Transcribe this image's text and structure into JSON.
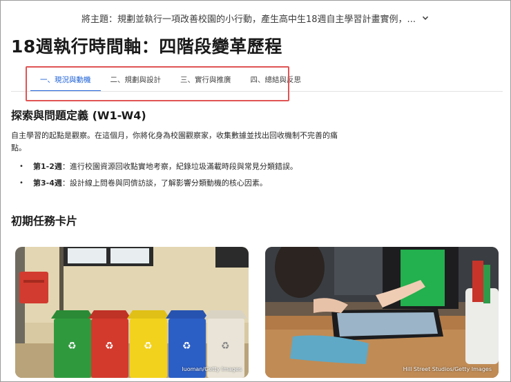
{
  "header": {
    "topic": "將主題：規劃並執行一項改善校園的小行動，產生高中生18週自主學習計畫實例，..."
  },
  "page": {
    "title": "18週執行時間軸：四階段變革歷程"
  },
  "tabs": [
    {
      "label": "一、現況與動機",
      "active": true
    },
    {
      "label": "二、規劃與設計",
      "active": false
    },
    {
      "label": "三、實行與推廣",
      "active": false
    },
    {
      "label": "四、總結與反思",
      "active": false
    }
  ],
  "section": {
    "heading": "探索與問題定義 (W1-W4)",
    "intro": "自主學習的起點是觀察。在這個月，你將化身為校園觀察家，收集數據並找出回收機制不完善的痛點。",
    "bullets": [
      {
        "lead": "第1-2週",
        "text": "：進行校園資源回收點實地考察，紀錄垃圾滿載時段與常見分類錯誤。"
      },
      {
        "lead": "第3-4週",
        "text": "：設計線上問卷與同儕訪談，了解影響分類動機的核心因素。"
      }
    ]
  },
  "cards": {
    "heading": "初期任務卡片",
    "items": [
      {
        "credit": "luoman/Getty Images",
        "icon": "recycling-bins-photo"
      },
      {
        "credit": "Hill Street Studios/Getty Images",
        "icon": "tablet-collaboration-photo"
      }
    ]
  },
  "colors": {
    "accent": "#1a5fd6",
    "highlight": "#e05353"
  }
}
